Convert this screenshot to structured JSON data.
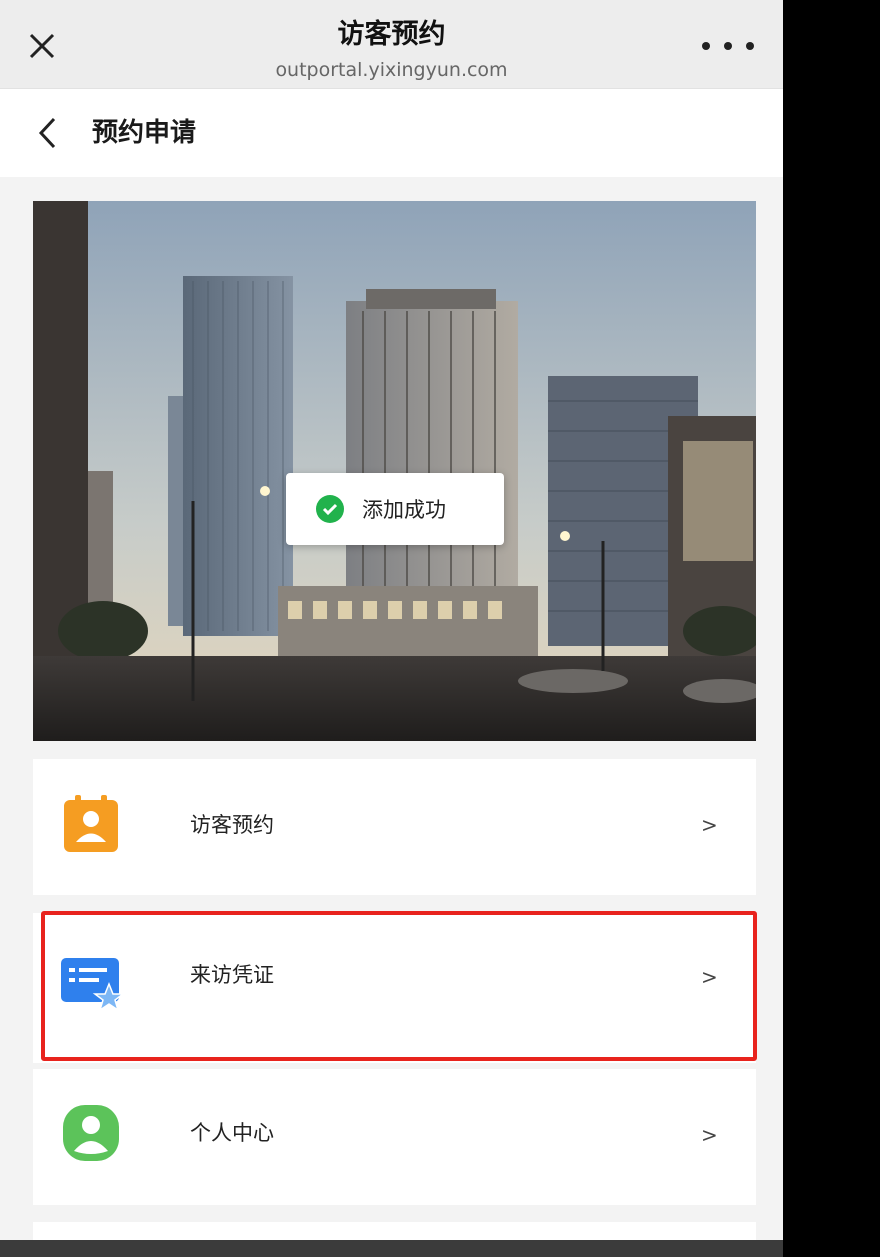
{
  "topbar": {
    "title": "访客预约",
    "url": "outportal.yixingyun.com",
    "close_icon": "close-icon",
    "more_icon": "more-icon"
  },
  "page": {
    "title": "预约申请",
    "back_icon": "chevron-left-icon"
  },
  "toast": {
    "text": "添加成功",
    "icon": "check-circle-icon",
    "color": "#21b24c"
  },
  "menu": [
    {
      "label": "访客预约",
      "arrow": ">",
      "icon": "visitor-calendar-icon",
      "color": "#f59d22"
    },
    {
      "label": "来访凭证",
      "arrow": ">",
      "icon": "credential-card-icon",
      "color": "#2f80ed"
    },
    {
      "label": "个人中心",
      "arrow": ">",
      "icon": "user-icon",
      "color": "#5cc35a"
    }
  ],
  "highlight_color": "#e8231d"
}
